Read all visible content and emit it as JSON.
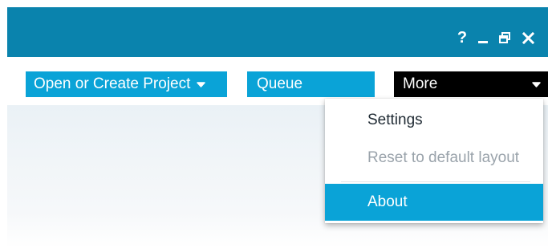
{
  "window": {
    "controls": {
      "help_label": "?"
    }
  },
  "toolbar": {
    "open_project_label": "Open or Create Project",
    "queue_label": "Queue",
    "more_label": "More"
  },
  "more_menu": {
    "items": [
      {
        "label": "Settings",
        "enabled": true,
        "highlighted": false
      },
      {
        "label": "Reset to default layout",
        "enabled": false,
        "highlighted": false
      },
      {
        "label": "About",
        "enabled": true,
        "highlighted": true
      }
    ]
  },
  "colors": {
    "titlebar": "#0a83ad",
    "accent": "#0aa3d7",
    "more_button": "#000000",
    "disabled_text": "#9aa3ab"
  },
  "icons": {
    "help": "question-mark-icon",
    "minimize": "minimize-icon",
    "restore": "restore-icon",
    "close": "close-icon",
    "dropdown": "chevron-down-icon"
  }
}
